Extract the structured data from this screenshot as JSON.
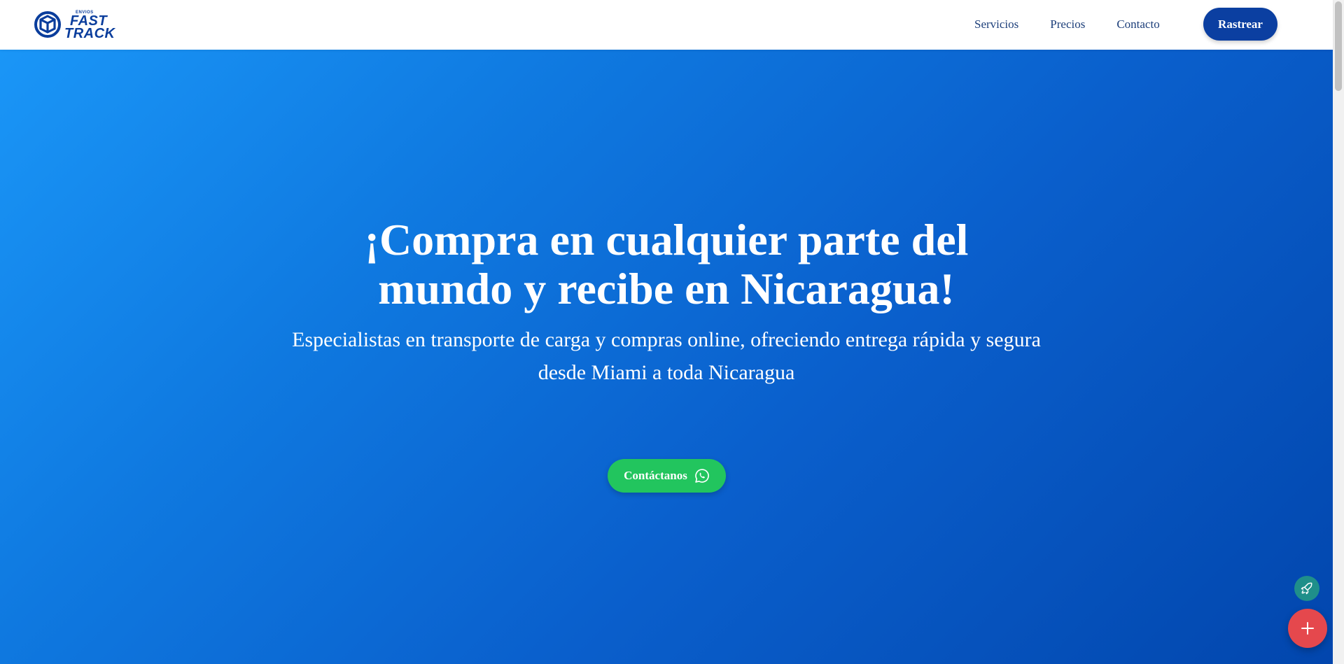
{
  "header": {
    "logo": {
      "small_text": "ENVIOS",
      "line1": "FAST",
      "line2": "TRACK"
    },
    "nav": [
      {
        "label": "Servicios"
      },
      {
        "label": "Precios"
      },
      {
        "label": "Contacto"
      }
    ],
    "track_button": "Rastrear"
  },
  "hero": {
    "title": "¡Compra en cualquier parte del mundo y recibe en Nicaragua!",
    "subtitle": "Especialistas en transporte de carga y compras online, ofreciendo entrega rápida y segura desde Miami a toda Nicaragua",
    "cta_label": "Contáctanos",
    "cta_icon": "whatsapp-icon"
  },
  "floating": {
    "small_icon": "rocket-icon",
    "big_icon": "plus-icon"
  },
  "colors": {
    "brand_blue": "#0b3fa1",
    "hero_gradient_start": "#1a96f7",
    "hero_gradient_end": "#0246ad",
    "cta_green": "#22c55e",
    "float_teal": "#1f8f8a",
    "float_red": "#e5484d"
  }
}
